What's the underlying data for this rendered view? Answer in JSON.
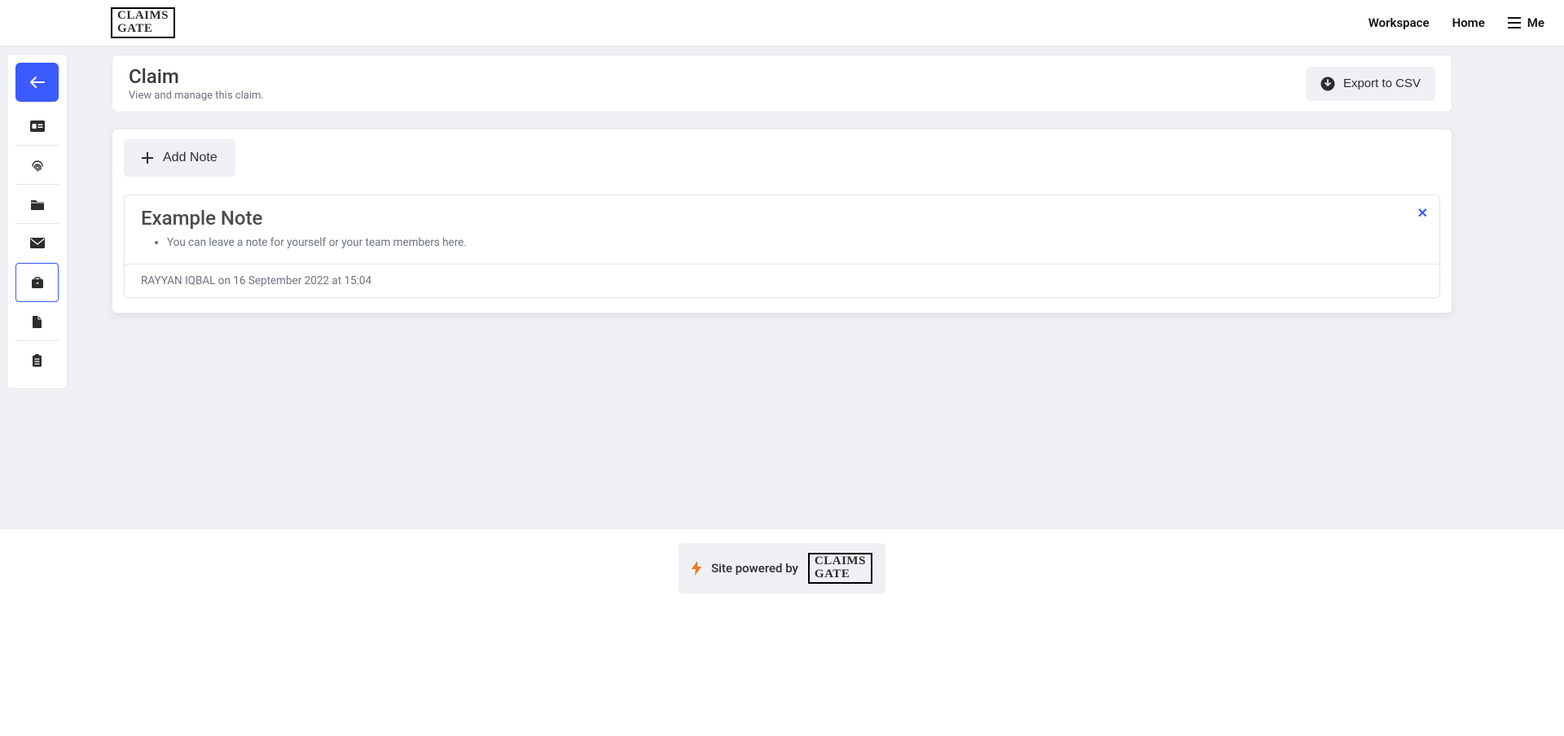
{
  "brand": {
    "line1": "CLAIMS",
    "line2": "GATE"
  },
  "nav": {
    "workspace": "Workspace",
    "home": "Home",
    "me": "Me"
  },
  "sidebar": {
    "items": [
      {
        "name": "back"
      },
      {
        "name": "id-card"
      },
      {
        "name": "fingerprint"
      },
      {
        "name": "folder"
      },
      {
        "name": "envelope"
      },
      {
        "name": "briefcase",
        "active": true
      },
      {
        "name": "document"
      },
      {
        "name": "clipboard"
      }
    ]
  },
  "claim": {
    "title": "Claim",
    "subtitle": "View and manage this claim.",
    "export_label": "Export to CSV"
  },
  "notes": {
    "add_label": "Add Note",
    "items": [
      {
        "title": "Example Note",
        "body": "You can leave a note for yourself or your team members here.",
        "author": "RAYYAN IQBAL",
        "date": "16 September 2022",
        "time": "15:04",
        "footer": "RAYYAN IQBAL on 16 September 2022 at 15:04"
      }
    ]
  },
  "footer": {
    "text": "Site powered by"
  }
}
